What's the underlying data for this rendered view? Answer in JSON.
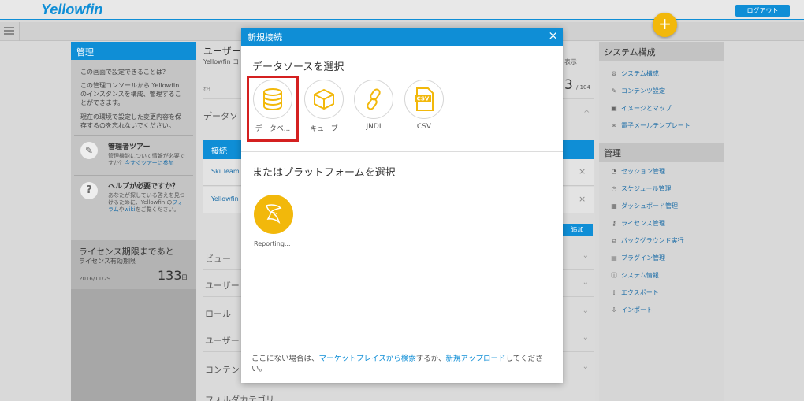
{
  "app": {
    "logo_text": "Yellowfin",
    "logout_label": "ログアウト",
    "plus_icon": "+"
  },
  "left_panel": {
    "title": "管理",
    "intro_q": "この画面で設定できることは？",
    "intro_text": "この管理コンソールから Yellowfin のインスタンスを構成、管理することができます。",
    "note_text": "現在の環境で設定した変更内容を保存するのを忘れないでください。",
    "tour_title": "管理者ツアー",
    "tour_text": "管理機能について情報が必要ですか？",
    "tour_link": "今すぐツアーに参加",
    "help_title": "ヘルプが必要ですか？",
    "help_text_1": "あなたが探している答えを見つけるために、Yellowfin の",
    "help_link": "フォーラム",
    "help_text_2": "や",
    "help_wiki": "wiki",
    "help_text_3": "をご覧ください。",
    "license_title": "ライセンス期限まであと",
    "license_sub": "ライセンス有効期限",
    "license_date": "2016/11/29",
    "license_days": "133",
    "license_unit": "日"
  },
  "middle": {
    "user_title": "ユーザー",
    "user_sub": "Yellowfin コ",
    "count_label": "表示",
    "count_value": "3",
    "count_total": "/ 104",
    "datasource_header": "データソ",
    "conn_tab": "接続",
    "conn_row1": "Ski Team",
    "conn_row2": "Yellowfin",
    "add_btn": "追加",
    "small_line": "ｵﾗｲ",
    "sections": [
      "ビュー",
      "ユーザー",
      "ロール",
      "ユーザー",
      "コンテン",
      "フォルダカテゴリ"
    ]
  },
  "right_panel": {
    "system_title": "システム構成",
    "system_items": [
      {
        "label": "システム構成",
        "icon": "gear-icon"
      },
      {
        "label": "コンテンツ設定",
        "icon": "pencil-icon"
      },
      {
        "label": "イメージとマップ",
        "icon": "image-icon"
      },
      {
        "label": "電子メールテンプレート",
        "icon": "mail-icon"
      }
    ],
    "admin_title": "管理",
    "admin_items": [
      {
        "label": "セッション管理",
        "icon": "session-icon"
      },
      {
        "label": "スケジュール管理",
        "icon": "clock-icon"
      },
      {
        "label": "ダッシュボード管理",
        "icon": "calendar-icon"
      },
      {
        "label": "ライセンス管理",
        "icon": "key-icon"
      },
      {
        "label": "バックグラウンド実行",
        "icon": "background-icon"
      },
      {
        "label": "プラグイン管理",
        "icon": "plugin-icon"
      },
      {
        "label": "システム情報",
        "icon": "info-icon"
      },
      {
        "label": "エクスポート",
        "icon": "export-icon"
      },
      {
        "label": "インポート",
        "icon": "import-icon"
      }
    ]
  },
  "modal": {
    "title": "新規接続",
    "close_icon": "×",
    "select_source": "データソースを選択",
    "tiles": [
      {
        "label": "データベ...",
        "icon": "database-icon"
      },
      {
        "label": "キューブ",
        "icon": "cube-icon"
      },
      {
        "label": "JNDI",
        "icon": "link-icon"
      },
      {
        "label": "CSV",
        "icon": "csv-icon"
      }
    ],
    "select_platform": "またはプラットフォームを選択",
    "platform_label": "Reporting...",
    "footer_1": "ここにない場合は、",
    "footer_link1": "マーケットプレイスから検索",
    "footer_2": "するか、",
    "footer_link2": "新規アップロード",
    "footer_3": "してください。"
  },
  "colors": {
    "accent": "#0f8ed6",
    "yellow": "#f2b80b",
    "select_border": "#d42020"
  }
}
